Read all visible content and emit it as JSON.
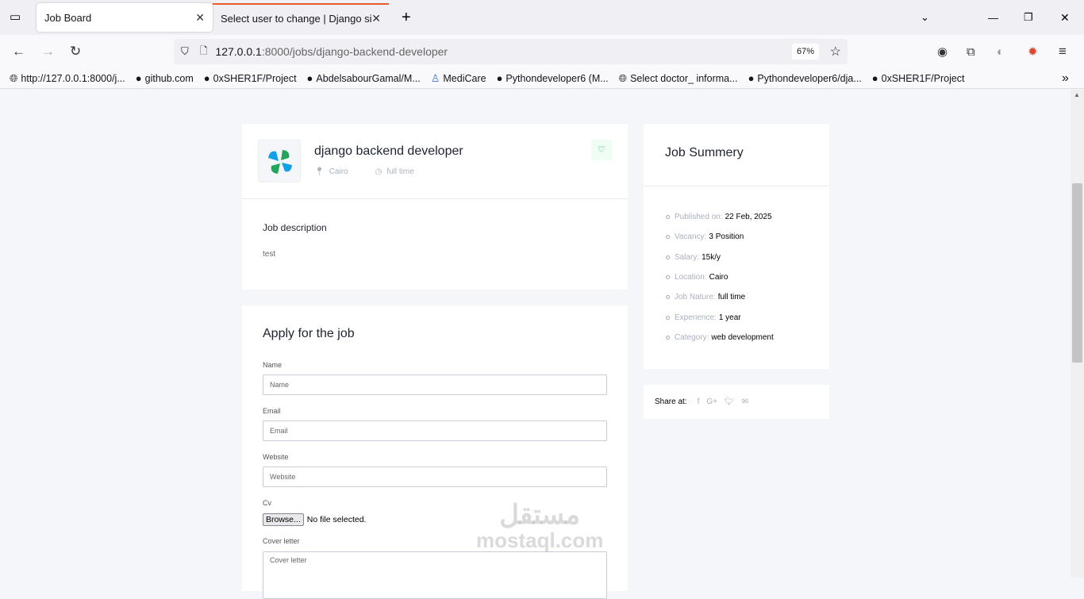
{
  "browser": {
    "tabs": [
      {
        "label": "Job Board"
      },
      {
        "label": "Select user to change | Django site a"
      }
    ],
    "url_host": "127.0.0.1",
    "url_rest": ":8000/jobs/django-backend-developer",
    "zoom": "67%",
    "bookmarks": [
      "http://127.0.0.1:8000/j...",
      "github.com",
      "0xSHER1F/Project",
      "AbdelsabourGamal/M...",
      "MediCare",
      "Pythondeveloper6 (M...",
      "Select doctor_ informa...",
      "Pythondeveloper6/dja...",
      "0xSHER1F/Project"
    ]
  },
  "job": {
    "title": "django backend developer",
    "location": "Cairo",
    "type": "full time",
    "desc_heading": "Job description",
    "desc": "test"
  },
  "apply": {
    "heading": "Apply for the job",
    "name_label": "Name",
    "name_ph": "Name",
    "email_label": "Email",
    "email_ph": "Email",
    "website_label": "Website",
    "website_ph": "Website",
    "cv_label": "Cv",
    "browse": "Browse...",
    "no_file": "No file selected.",
    "cover_label": "Cover letter",
    "cover_ph": "Cover letter"
  },
  "summary": {
    "heading": "Job Summery",
    "items": [
      {
        "k": "Published on:",
        "v": "22 Feb, 2025"
      },
      {
        "k": "Vacancy:",
        "v": "3 Position"
      },
      {
        "k": "Salary:",
        "v": "15k/y"
      },
      {
        "k": "Location:",
        "v": "Cairo"
      },
      {
        "k": "Job Nature:",
        "v": "full time"
      },
      {
        "k": "Experience:",
        "v": "1 year"
      },
      {
        "k": "Category:",
        "v": "web development"
      }
    ]
  },
  "share": {
    "label": "Share at:"
  },
  "watermark": {
    "ar": "مستقل",
    "en": "mostaql.com"
  },
  "colors": {
    "accent": "#00d363",
    "page_bg": "#f5f6fa"
  }
}
